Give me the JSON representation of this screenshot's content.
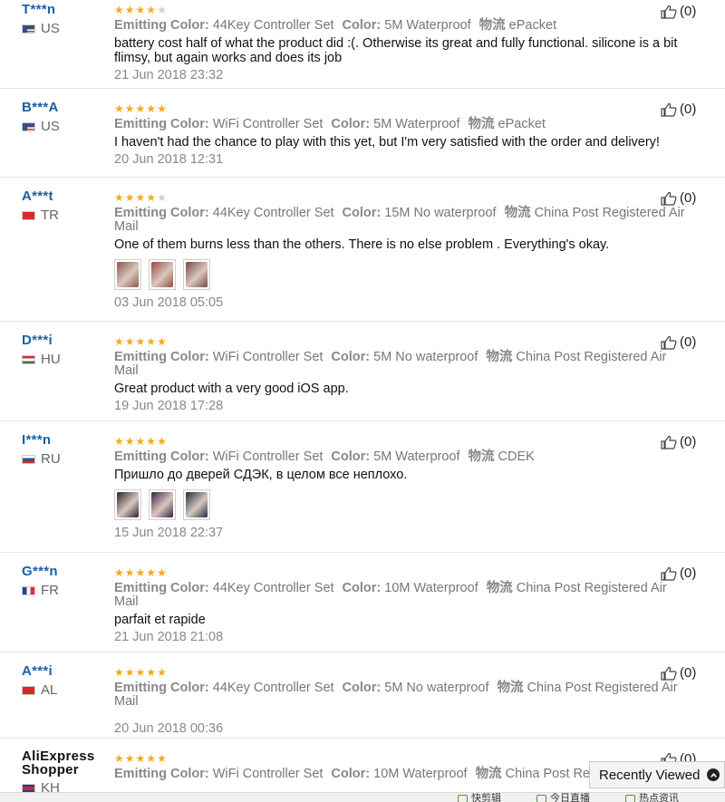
{
  "reviews": [
    {
      "user": "T***n",
      "country": "US",
      "flag": "us",
      "stars": 4,
      "attrs": [
        {
          "key": "Emitting Color:",
          "value": "44Key Controller Set"
        },
        {
          "key": "Color:",
          "value": "5M Waterproof"
        },
        {
          "key": "物流",
          "value": "ePacket"
        }
      ],
      "text": "battery cost half of what the product did :(. Otherwise its great and fully functional. silicone is a bit flimsy, but again works and does its job",
      "date": "21 Jun 2018 23:32",
      "useful": "(0)",
      "photos": []
    },
    {
      "user": "B***A",
      "country": "US",
      "flag": "us",
      "stars": 5,
      "attrs": [
        {
          "key": "Emitting Color:",
          "value": "WiFi Controller Set"
        },
        {
          "key": "Color:",
          "value": "5M Waterproof"
        },
        {
          "key": "物流",
          "value": "ePacket"
        }
      ],
      "text": "I haven't had the chance to play with this yet, but I'm very satisfied with the order and delivery!",
      "date": "20 Jun 2018 12:31",
      "useful": "(0)",
      "photos": []
    },
    {
      "user": "A***t",
      "country": "TR",
      "flag": "tr",
      "stars": 4,
      "attrs": [
        {
          "key": "Emitting Color:",
          "value": "44Key Controller Set"
        },
        {
          "key": "Color:",
          "value": "15M No waterproof"
        },
        {
          "key": "物流",
          "value": "China Post Registered Air Mail"
        }
      ],
      "text": "One of them burns less than the others. There is no else problem . Everything's okay.",
      "date": "03 Jun 2018 05:05",
      "useful": "(0)",
      "photos": [
        "#8a5a4a",
        "#9a4a3e",
        "#7a4a44"
      ]
    },
    {
      "user": "D***i",
      "country": "HU",
      "flag": "hu",
      "stars": 5,
      "attrs": [
        {
          "key": "Emitting Color:",
          "value": "WiFi Controller Set"
        },
        {
          "key": "Color:",
          "value": "5M No waterproof"
        },
        {
          "key": "物流",
          "value": "China Post Registered Air Mail"
        }
      ],
      "text": "Great product with a very good iOS app.",
      "date": "19 Jun 2018 17:28",
      "useful": "(0)",
      "photos": []
    },
    {
      "user": "I***n",
      "country": "RU",
      "flag": "ru",
      "stars": 5,
      "attrs": [
        {
          "key": "Emitting Color:",
          "value": "WiFi Controller Set"
        },
        {
          "key": "Color:",
          "value": "5M Waterproof"
        },
        {
          "key": "物流",
          "value": "CDEK"
        }
      ],
      "text": "Пришло до дверей СДЭК, в целом все неплохо.",
      "date": "15 Jun 2018 22:37",
      "useful": "(0)",
      "photos": [
        "#2a2230",
        "#3a2244",
        "#1f2a44"
      ]
    },
    {
      "user": "G***n",
      "country": "FR",
      "flag": "fr",
      "stars": 5,
      "attrs": [
        {
          "key": "Emitting Color:",
          "value": "44Key Controller Set"
        },
        {
          "key": "Color:",
          "value": "10M Waterproof"
        },
        {
          "key": "物流",
          "value": "China Post Registered Air Mail"
        }
      ],
      "text": "parfait et rapide",
      "date": "21 Jun 2018 21:08",
      "useful": "(0)",
      "photos": []
    },
    {
      "user": "A***i",
      "country": "AL",
      "flag": "al",
      "stars": 5,
      "attrs": [
        {
          "key": "Emitting Color:",
          "value": "44Key Controller Set"
        },
        {
          "key": "Color:",
          "value": "5M No waterproof"
        },
        {
          "key": "物流",
          "value": "China Post Registered Air Mail"
        }
      ],
      "text": "",
      "date": "20 Jun 2018 00:36",
      "useful": "(0)",
      "photos": []
    },
    {
      "user": "AliExpress Shopper",
      "country": "KH",
      "flag": "kh",
      "stars": 5,
      "shop": true,
      "attrs": [
        {
          "key": "Emitting Color:",
          "value": "WiFi Controller Set"
        },
        {
          "key": "Color:",
          "value": "10M Waterproof"
        },
        {
          "key": "物流",
          "value": "China Post Registered Air Mail"
        }
      ],
      "text": "",
      "date": "",
      "useful": "(0)",
      "photos": []
    }
  ],
  "recently_viewed": {
    "label": "Recently Viewed"
  },
  "taskbar": {
    "items": [
      "快剪辑",
      "今日直播",
      "热点资讯"
    ]
  },
  "colors": {
    "link": "#1a5fa8",
    "star": "#f7a91b"
  }
}
